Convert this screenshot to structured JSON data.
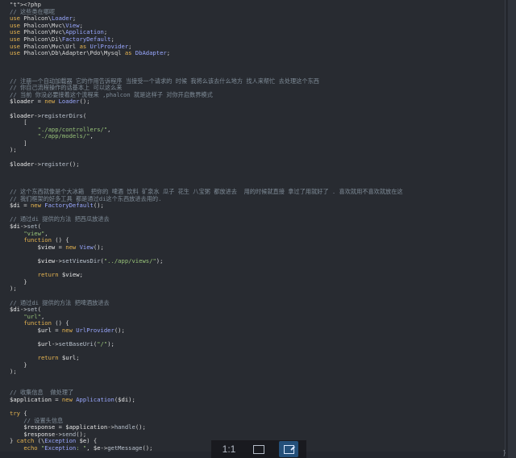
{
  "code_lines": [
    "<?php",
    "// 这些类在哪呢",
    "use Phalcon\\Loader;",
    "use Phalcon\\Mvc\\View;",
    "use Phalcon\\Mvc\\Application;",
    "use Phalcon\\Di\\FactoryDefault;",
    "use Phalcon\\Mvc\\Url as UrlProvider;",
    "use Phalcon\\Db\\Adapter\\Pdo\\Mysql as DbAdapter;",
    "",
    "",
    "",
    "// 注册一个自动加载器 它的作用告诉程序 当接受一个请求的 时候 我将么该去什么地方 找人来帮忙 去处理这个东西",
    "// 你自己流程操作的话基本上 可以这么来",
    "// 当前 你没必要接着这个流程来 ,phalcon 就是这样子 对你开启数界模式",
    "$loader = new Loader();",
    "",
    "$loader->registerDirs(",
    "    [",
    "        \"./app/controllers/\",",
    "        \"./app/models/\",",
    "    ]",
    ");",
    "",
    "$loader->register();",
    "",
    "",
    "",
    "// 这个东西就像是个大冰箱  把你的 啤酒 饮料 矿泉水 瓜子 花生 八宝粥 都放进去  用的时候就直接 拿过了用就好了 . 喜欢就用不喜欢就放在这",
    "// 我们框架的好多工具 都是通过di这个东西放进去用的.",
    "$di = new FactoryDefault();",
    "",
    "// 通过di 提供的方法 把西瓜放进去",
    "$di->set(",
    "    \"view\",",
    "    function () {",
    "        $view = new View();",
    "",
    "        $view->setViewsDir(\"../app/views/\");",
    "",
    "        return $view;",
    "    }",
    ");",
    "",
    "// 通过di 提供的方法 把啤酒放进去",
    "$di->set(",
    "    \"url\",",
    "    function () {",
    "        $url = new UrlProvider();",
    "",
    "        $url->setBaseUri(\"/\");",
    "",
    "        return $url;",
    "    }",
    ");",
    "",
    "",
    "// 收集信息  做处理了",
    "$application = new Application($di);",
    "",
    "try {",
    "    // 设置头信息",
    "    $response = $application->handle();",
    "    $response->send();",
    "} catch (\\Exception $e) {",
    "    echo \"Exception: \", $e->getMessage();"
  ],
  "toolbar": {
    "fit_label": "1:1",
    "fullscreen_icon": "fullscreen-icon",
    "edit_icon": "edit-icon"
  },
  "corner_label": "}"
}
